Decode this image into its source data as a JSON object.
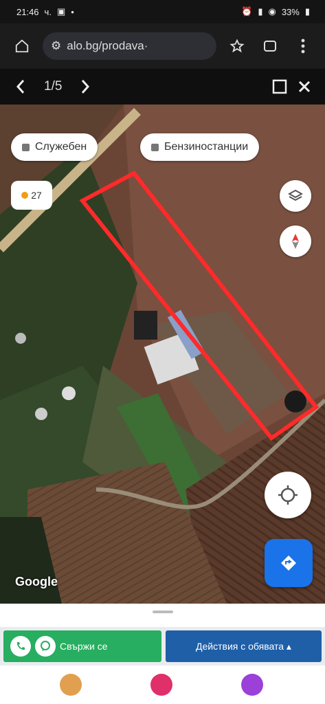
{
  "status": {
    "time": "21:46",
    "carrier": "ч.",
    "right_text": "33%"
  },
  "browser": {
    "url": "alo.bg/prodava·"
  },
  "gallery": {
    "counter": "1/5"
  },
  "map": {
    "chip_1": "Служебен",
    "chip_2": "Бензиностанции",
    "temperature": "27",
    "attribution": "Google"
  },
  "actions": {
    "contact_label": "Свържи се",
    "ad_actions_label": "Действия с обявата ▴"
  },
  "dock_colors": [
    "#e0a050",
    "#e0306a",
    "#9b40d8"
  ]
}
